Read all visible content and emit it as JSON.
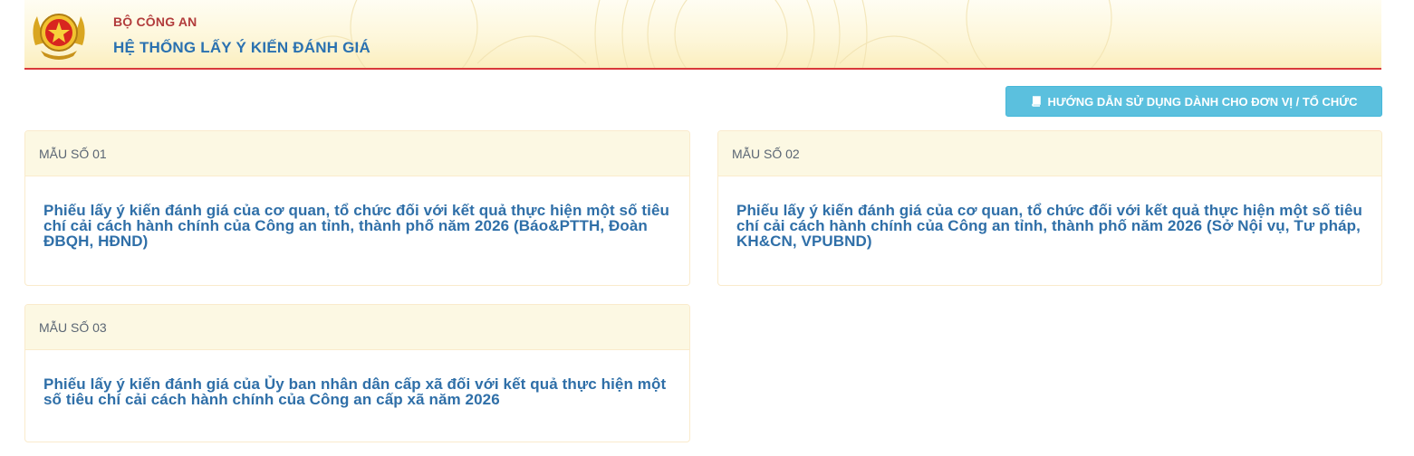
{
  "header": {
    "org_name": "BỘ CÔNG AN",
    "system_title": "HỆ THỐNG LẤY Ý KIẾN ĐÁNH GIÁ",
    "logo_icon": "police-emblem-icon"
  },
  "toolbar": {
    "guide_label": "HƯỚNG DẪN SỬ DỤNG DÀNH CHO ĐƠN VỊ / TỔ CHỨC",
    "guide_icon": "book-icon"
  },
  "forms": [
    {
      "code": "MẪU SỐ 01",
      "title": "Phiếu lấy ý kiến đánh giá của cơ quan, tổ chức đối với kết quả thực hiện một số tiêu chí cải cách hành chính của Công an tỉnh, thành phố năm 2026 (Báo&PTTH, Đoàn ĐBQH, HĐND)"
    },
    {
      "code": "MẪU SỐ 02",
      "title": "Phiếu lấy ý kiến đánh giá của cơ quan, tổ chức đối với kết quả thực hiện một số tiêu chí cải cách hành chính của Công an tỉnh, thành phố năm 2026 (Sở Nội vụ, Tư pháp, KH&CN, VPUBND)"
    },
    {
      "code": "MẪU SỐ 03",
      "title": "Phiếu lấy ý kiến đánh giá của Ủy ban nhân dân cấp xã đối với kết quả thực hiện một số tiêu chí cải cách hành chính của Công an cấp xã năm 2026"
    }
  ],
  "colors": {
    "header_line": "#d9383a",
    "org_text": "#b23c3c",
    "title_text": "#2a71b0",
    "button_bg": "#5bc0de",
    "card_head_bg": "#fcf8e3",
    "card_border": "#faebcc",
    "card_title_text": "#2f6fa8"
  }
}
